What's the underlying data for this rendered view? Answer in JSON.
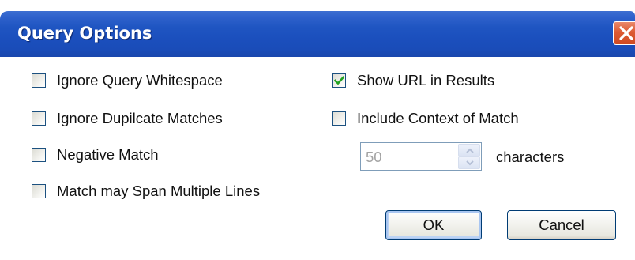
{
  "window": {
    "title": "Query Options",
    "close_icon": "close-icon"
  },
  "options": {
    "ignore_whitespace": {
      "label": "Ignore Query Whitespace",
      "checked": false
    },
    "ignore_duplicate": {
      "label": "Ignore Dupilcate Matches",
      "checked": false
    },
    "negative_match": {
      "label": "Negative Match",
      "checked": false
    },
    "span_lines": {
      "label": "Match may Span Multiple Lines",
      "checked": false
    },
    "show_url": {
      "label": "Show URL in Results",
      "checked": true
    },
    "include_context": {
      "label": "Include Context of Match",
      "checked": false
    }
  },
  "context_chars": {
    "value": "50",
    "unit_label": "characters",
    "enabled": false
  },
  "buttons": {
    "ok_label": "OK",
    "cancel_label": "Cancel"
  },
  "colors": {
    "title_bar": "#1f55c2",
    "close_button": "#dd5a33",
    "checkmark": "#21a121",
    "checkbox_border": "#1c5180"
  }
}
